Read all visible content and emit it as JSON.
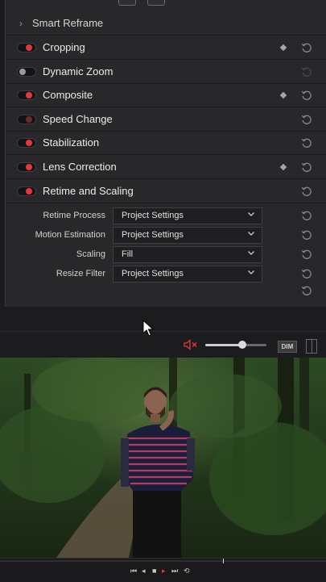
{
  "inspector": {
    "smart_reframe": "Smart Reframe",
    "sections": [
      {
        "label": "Cropping",
        "state": "on",
        "keyframe": true,
        "reset_dim": false
      },
      {
        "label": "Dynamic Zoom",
        "state": "off",
        "keyframe": false,
        "reset_dim": true
      },
      {
        "label": "Composite",
        "state": "on",
        "keyframe": true,
        "reset_dim": false
      },
      {
        "label": "Speed Change",
        "state": "dim",
        "keyframe": false,
        "reset_dim": false
      },
      {
        "label": "Stabilization",
        "state": "on",
        "keyframe": false,
        "reset_dim": false
      },
      {
        "label": "Lens Correction",
        "state": "on",
        "keyframe": true,
        "reset_dim": false
      },
      {
        "label": "Retime and Scaling",
        "state": "on",
        "keyframe": false,
        "reset_dim": false
      }
    ],
    "retime": {
      "props": [
        {
          "label": "Retime Process",
          "value": "Project Settings"
        },
        {
          "label": "Motion Estimation",
          "value": "Project Settings"
        },
        {
          "label": "Scaling",
          "value": "Fill"
        },
        {
          "label": "Resize Filter",
          "value": "Project Settings"
        }
      ]
    }
  },
  "viewer": {
    "volume_level": 0.6,
    "dim_label": "DIM",
    "muted": true
  },
  "colors": {
    "accent_red": "#e5383b",
    "panel_bg": "#28282b"
  },
  "icons": {
    "reset": "reset-icon",
    "keyframe": "keyframe-diamond-icon",
    "mute": "speaker-muted-icon"
  }
}
